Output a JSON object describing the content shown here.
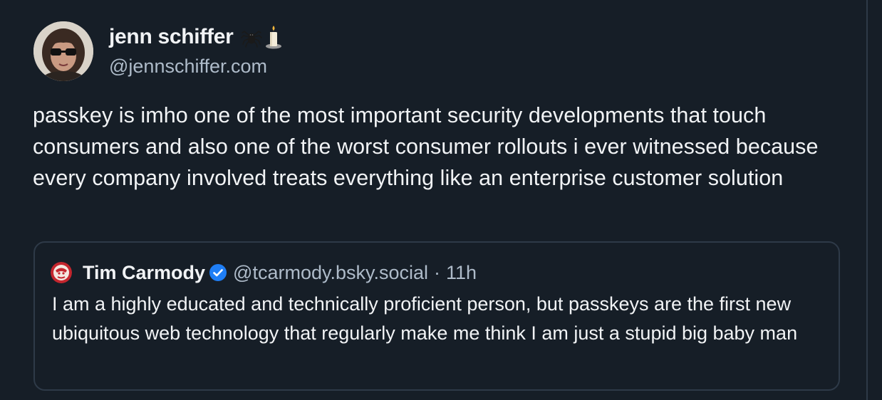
{
  "post": {
    "author": {
      "display_name": "jenn schiffer",
      "name_emojis": [
        "spider-icon",
        "candle-icon"
      ],
      "handle": "@jennschiffer.com"
    },
    "text": "passkey is imho one of the most important security developments that touch consumers and also one of the worst consumer rollouts i ever witnessed because every company involved treats everything like an enterprise customer solution"
  },
  "quote": {
    "author": {
      "display_name": "Tim Carmody",
      "verified": true,
      "handle": "@tcarmody.bsky.social"
    },
    "separator": "·",
    "time": "11h",
    "text": "I am a highly educated and technically proficient person, but passkeys are the first new ubiquitous web technology that regularly make me think I am just a stupid big baby man"
  },
  "colors": {
    "background": "#161e27",
    "border": "#2e3a48",
    "text_primary": "#f1f3f5",
    "text_secondary": "#aebbc9",
    "verified_blue": "#1f7ef5"
  }
}
